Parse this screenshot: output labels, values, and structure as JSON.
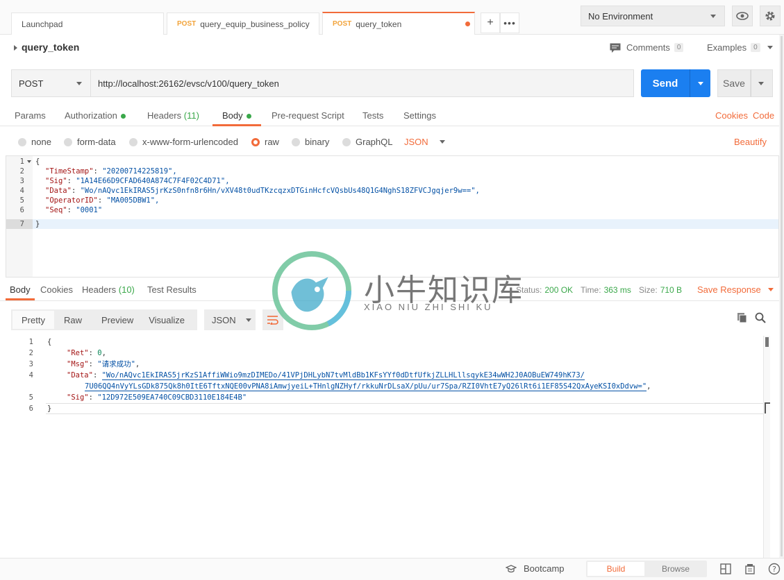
{
  "tabs": [
    {
      "method": "",
      "name": "Launchpad"
    },
    {
      "method": "POST",
      "name": "query_equip_business_policy"
    },
    {
      "method": "POST",
      "name": "query_token"
    }
  ],
  "environment": "No Environment",
  "request": {
    "title": "query_token",
    "comments_label": "Comments",
    "comments_count": "0",
    "examples_label": "Examples",
    "examples_count": "0",
    "method": "POST",
    "url": "http://localhost:26162/evsc/v100/query_token",
    "send_label": "Send",
    "save_label": "Save"
  },
  "request_tabs": {
    "params": "Params",
    "authorization": "Authorization",
    "headers": "Headers",
    "headers_count": "(11)",
    "body": "Body",
    "prerequest": "Pre-request Script",
    "tests": "Tests",
    "settings": "Settings",
    "cookies": "Cookies",
    "code": "Code"
  },
  "body_types": {
    "none": "none",
    "form_data": "form-data",
    "urlencoded": "x-www-form-urlencoded",
    "raw": "raw",
    "binary": "binary",
    "graphql": "GraphQL",
    "format": "JSON",
    "beautify": "Beautify"
  },
  "request_body": {
    "line_numbers": [
      "1",
      "2",
      "3",
      "4",
      "5",
      "6",
      "7"
    ],
    "open": "{",
    "close": "}",
    "fields": [
      {
        "key": "\"TimeStamp\"",
        "value": "\"20200714225819\","
      },
      {
        "key": "\"Sig\"",
        "value": "\"1A14E66D9CFAD640A874C7F4F02C4D71\","
      },
      {
        "key": "\"Data\"",
        "value": "\"Wo/nAQvc1EkIRAS5jrKzS0nfn8r6Hn/vXV48t0udTKzcqzxDTGinHcfcVQsbUs48Q1G4NghS18ZFVCJgqjer9w==\","
      },
      {
        "key": "\"OperatorID\"",
        "value": "\"MA005DBW1\","
      },
      {
        "key": "\"Seq\"",
        "value": "\"0001\""
      }
    ]
  },
  "response_tabs": {
    "body": "Body",
    "cookies": "Cookies",
    "headers": "Headers",
    "headers_count": "(10)",
    "test_results": "Test Results",
    "status_label": "Status:",
    "status_value": "200 OK",
    "time_label": "Time:",
    "time_value": "363 ms",
    "size_label": "Size:",
    "size_value": "710 B",
    "save_response": "Save Response"
  },
  "response_view": {
    "pretty": "Pretty",
    "raw": "Raw",
    "preview": "Preview",
    "visualize": "Visualize",
    "format": "JSON"
  },
  "response_body": {
    "line_numbers": [
      "1",
      "2",
      "3",
      "4",
      "5",
      "6"
    ],
    "open": "{",
    "close": "}",
    "ret_key": "\"Ret\"",
    "ret_value": "0",
    "msg_key": "\"Msg\"",
    "msg_value": "\"请求成功\"",
    "data_key": "\"Data\"",
    "data_value_1": "\"Wo/nAQvc1EkIRAS5jrKzS1AffiWWio9mzDIMEDo/41VPjDHLybN7tvMldBb1KFsYYf0dDtfUfkjZLLHLllsqykE34wWH2J0AOBuEW749hK73/",
    "data_value_2": "7U06QQ4nVyYLsGDk875Qk8h0ItE6TftxNQE00vPNA8iAmwjyeiL+THnlgNZHyf/rkkuNrDLsaX/pUu/ur7Spa/RZI0VhtE7yQ26lRt6i1EF85S42QxAyeKSI0xDdvw=\"",
    "sig_key": "\"Sig\"",
    "sig_value": "\"12D972E509EA740C09CBD3110E184E4B\""
  },
  "watermark": {
    "chinese": "小牛知识库",
    "pinyin": "XIAO NIU ZHI SHI KU"
  },
  "footer": {
    "bootcamp": "Bootcamp",
    "build": "Build",
    "browse": "Browse"
  },
  "colors": {
    "accent": "#f26b3a",
    "send": "#1b7ff0",
    "success": "#3aa84a"
  }
}
